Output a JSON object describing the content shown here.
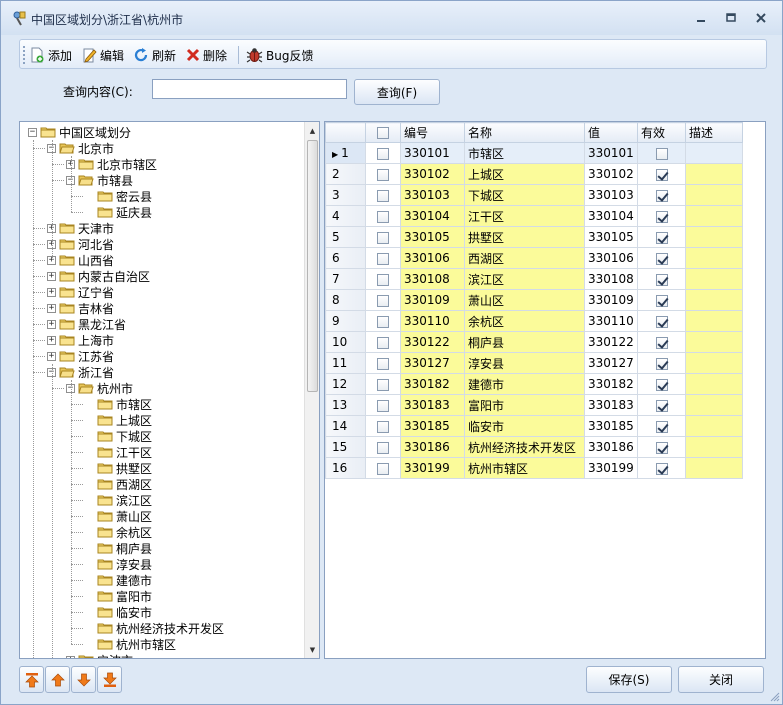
{
  "window": {
    "title": "中国区域划分\\浙江省\\杭州市"
  },
  "toolbar": {
    "add": "添加",
    "edit": "编辑",
    "refresh": "刷新",
    "delete": "删除",
    "bug": "Bug反馈"
  },
  "query": {
    "label": "查询内容(C):",
    "value": "",
    "button": "查询(F)"
  },
  "tree": {
    "root": "中国区域划分",
    "beijing": "北京市",
    "beijing_children": [
      "北京市辖区",
      "市辖县"
    ],
    "beijing_county_children": [
      "密云县",
      "延庆县"
    ],
    "provinces": [
      "天津市",
      "河北省",
      "山西省",
      "内蒙古自治区",
      "辽宁省",
      "吉林省",
      "黑龙江省",
      "上海市",
      "江苏省"
    ],
    "zhejiang": "浙江省",
    "hangzhou": "杭州市",
    "hangzhou_children": [
      "市辖区",
      "上城区",
      "下城区",
      "江干区",
      "拱墅区",
      "西湖区",
      "滨江区",
      "萧山区",
      "余杭区",
      "桐庐县",
      "淳安县",
      "建德市",
      "富阳市",
      "临安市",
      "杭州经济技术开发区",
      "杭州市辖区"
    ],
    "next": "宁波市"
  },
  "grid": {
    "columns": [
      "",
      "编号",
      "名称",
      "值",
      "有效",
      "描述"
    ],
    "rows": [
      {
        "n": "1",
        "code": "330101",
        "name": "市辖区",
        "value": "330101",
        "valid": false,
        "desc": ""
      },
      {
        "n": "2",
        "code": "330102",
        "name": "上城区",
        "value": "330102",
        "valid": true,
        "desc": ""
      },
      {
        "n": "3",
        "code": "330103",
        "name": "下城区",
        "value": "330103",
        "valid": true,
        "desc": ""
      },
      {
        "n": "4",
        "code": "330104",
        "name": "江干区",
        "value": "330104",
        "valid": true,
        "desc": ""
      },
      {
        "n": "5",
        "code": "330105",
        "name": "拱墅区",
        "value": "330105",
        "valid": true,
        "desc": ""
      },
      {
        "n": "6",
        "code": "330106",
        "name": "西湖区",
        "value": "330106",
        "valid": true,
        "desc": ""
      },
      {
        "n": "7",
        "code": "330108",
        "name": "滨江区",
        "value": "330108",
        "valid": true,
        "desc": ""
      },
      {
        "n": "8",
        "code": "330109",
        "name": "萧山区",
        "value": "330109",
        "valid": true,
        "desc": ""
      },
      {
        "n": "9",
        "code": "330110",
        "name": "余杭区",
        "value": "330110",
        "valid": true,
        "desc": ""
      },
      {
        "n": "10",
        "code": "330122",
        "name": "桐庐县",
        "value": "330122",
        "valid": true,
        "desc": ""
      },
      {
        "n": "11",
        "code": "330127",
        "name": "淳安县",
        "value": "330127",
        "valid": true,
        "desc": ""
      },
      {
        "n": "12",
        "code": "330182",
        "name": "建德市",
        "value": "330182",
        "valid": true,
        "desc": ""
      },
      {
        "n": "13",
        "code": "330183",
        "name": "富阳市",
        "value": "330183",
        "valid": true,
        "desc": ""
      },
      {
        "n": "14",
        "code": "330185",
        "name": "临安市",
        "value": "330185",
        "valid": true,
        "desc": ""
      },
      {
        "n": "15",
        "code": "330186",
        "name": "杭州经济技术开发区",
        "value": "330186",
        "valid": true,
        "desc": ""
      },
      {
        "n": "16",
        "code": "330199",
        "name": "杭州市辖区",
        "value": "330199",
        "valid": true,
        "desc": ""
      }
    ]
  },
  "footer": {
    "save": "保存(S)",
    "close": "关闭"
  },
  "colors": {
    "editable_cell": "#fbfb9a",
    "selected_row": "#e5eef9",
    "accent": "#8aa4c8"
  }
}
